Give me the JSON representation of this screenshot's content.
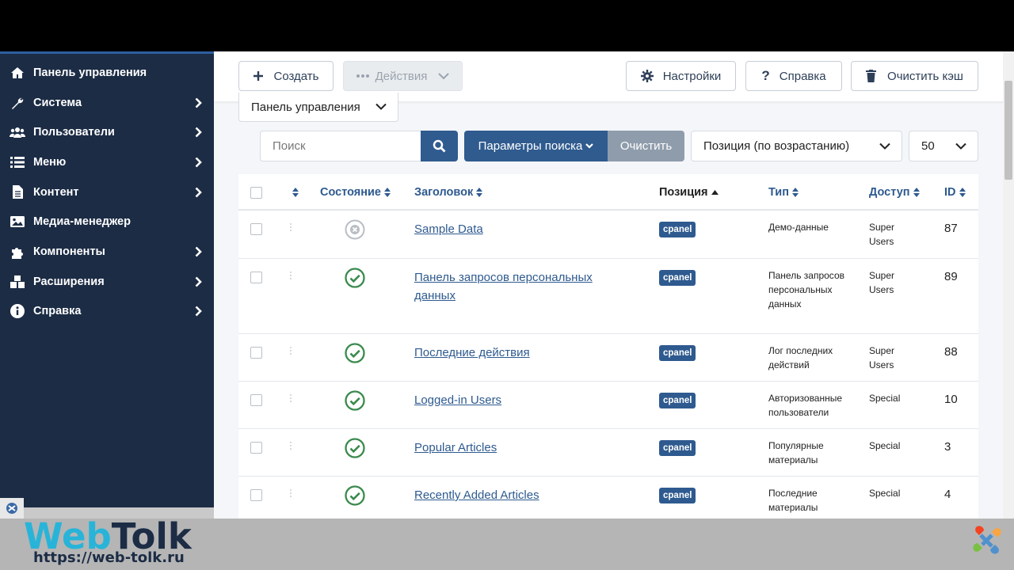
{
  "sidebar": {
    "items": [
      {
        "label": "Панель управления",
        "icon": "home-icon",
        "has_chevron": false
      },
      {
        "label": "Система",
        "icon": "wrench-icon",
        "has_chevron": true
      },
      {
        "label": "Пользователи",
        "icon": "users-icon",
        "has_chevron": true
      },
      {
        "label": "Меню",
        "icon": "list-icon",
        "has_chevron": true
      },
      {
        "label": "Контент",
        "icon": "file-icon",
        "has_chevron": true
      },
      {
        "label": "Медиа-менеджер",
        "icon": "image-icon",
        "has_chevron": false
      },
      {
        "label": "Компоненты",
        "icon": "puzzle-icon",
        "has_chevron": true
      },
      {
        "label": "Расширения",
        "icon": "cubes-icon",
        "has_chevron": true
      },
      {
        "label": "Справка",
        "icon": "info-icon",
        "has_chevron": true
      }
    ]
  },
  "toolbar": {
    "create_label": "Создать",
    "actions_label": "Действия",
    "settings_label": "Настройки",
    "help_label": "Справка",
    "clear_cache_label": "Очистить кэш"
  },
  "filters": {
    "client_select": "Панель управления",
    "search_placeholder": "Поиск",
    "search_options_label": "Параметры поиска",
    "clear_label": "Очистить",
    "ordering_select": "Позиция (по возрастанию)",
    "limit_select": "50"
  },
  "table": {
    "headers": {
      "state": "Состояние",
      "title": "Заголовок",
      "position": "Позиция",
      "type": "Тип",
      "access": "Доступ",
      "id": "ID"
    },
    "rows": [
      {
        "title": "Sample Data",
        "state": "unpublished",
        "position": "cpanel",
        "type": "Демо-данные",
        "access": "Super Users",
        "id": "87"
      },
      {
        "title": "Панель запросов персональных данных",
        "state": "published",
        "position": "cpanel",
        "type": "Панель запросов персональных данных",
        "access": "Super Users",
        "id": "89"
      },
      {
        "title": "Последние действия",
        "state": "published",
        "position": "cpanel",
        "type": "Лог последних действий",
        "access": "Super Users",
        "id": "88"
      },
      {
        "title": "Logged-in Users",
        "state": "published",
        "position": "cpanel",
        "type": "Авторизованные пользователи",
        "access": "Special",
        "id": "10"
      },
      {
        "title": "Popular Articles",
        "state": "published",
        "position": "cpanel",
        "type": "Популярные материалы",
        "access": "Special",
        "id": "3"
      },
      {
        "title": "Recently Added Articles",
        "state": "published",
        "position": "cpanel",
        "type": "Последние материалы",
        "access": "Special",
        "id": "4"
      }
    ]
  },
  "watermark": {
    "brand_web": "Web",
    "brand_tolk": "Tolk",
    "url": "https://web-tolk.ru"
  },
  "colors": {
    "sidebar_bg": "#1c2c45",
    "primary": "#2f5b8f",
    "link": "#2e5a8f",
    "published": "#3a8a4e",
    "unpublished": "#b9bec5"
  }
}
